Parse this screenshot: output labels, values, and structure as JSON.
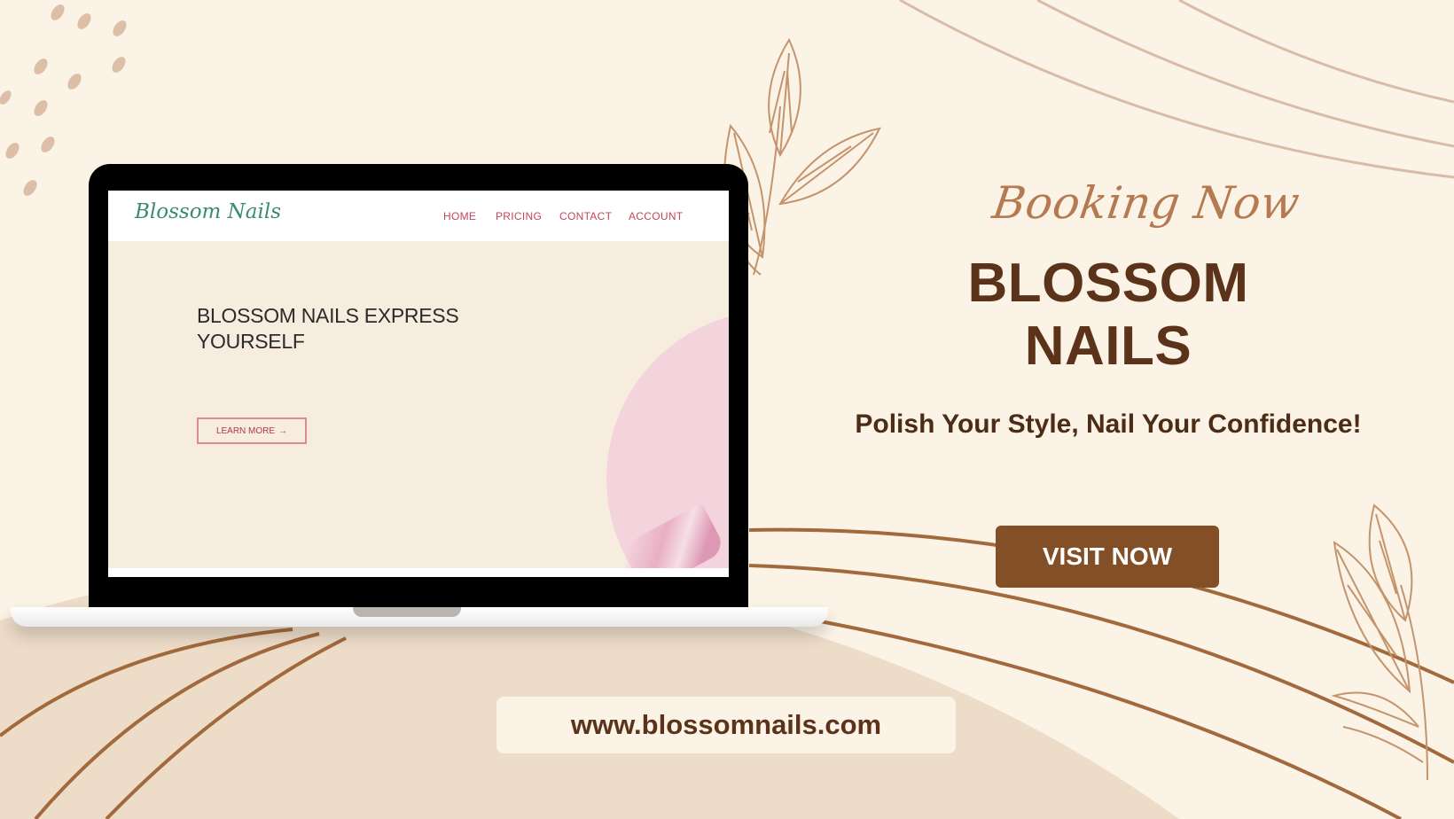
{
  "colors": {
    "background": "#fbf3e6",
    "accent_brown": "#824f26",
    "dark_brown": "#5b331b",
    "script_tan": "#b57a52",
    "nav_pink": "#c2455a",
    "logo_green": "#3a8c6a"
  },
  "laptop": {
    "site": {
      "logo": "Blossom Nails",
      "nav": [
        "HOME",
        "PRICING",
        "CONTACT",
        "ACCOUNT"
      ],
      "hero_title": "BLOSSOM NAILS EXPRESS YOURSELF",
      "learn_more": "LEARN MORE",
      "learn_more_icon": "→"
    }
  },
  "promo": {
    "script_heading": "Booking Now",
    "title": "BLOSSOM NAILS",
    "tagline": "Polish Your Style, Nail Your Confidence!",
    "cta": "VISIT NOW",
    "url": "www.blossomnails.com"
  },
  "icons": {
    "decor_leaf": "leaf-branch-icon",
    "decor_dots": "dot-pattern-icon"
  }
}
